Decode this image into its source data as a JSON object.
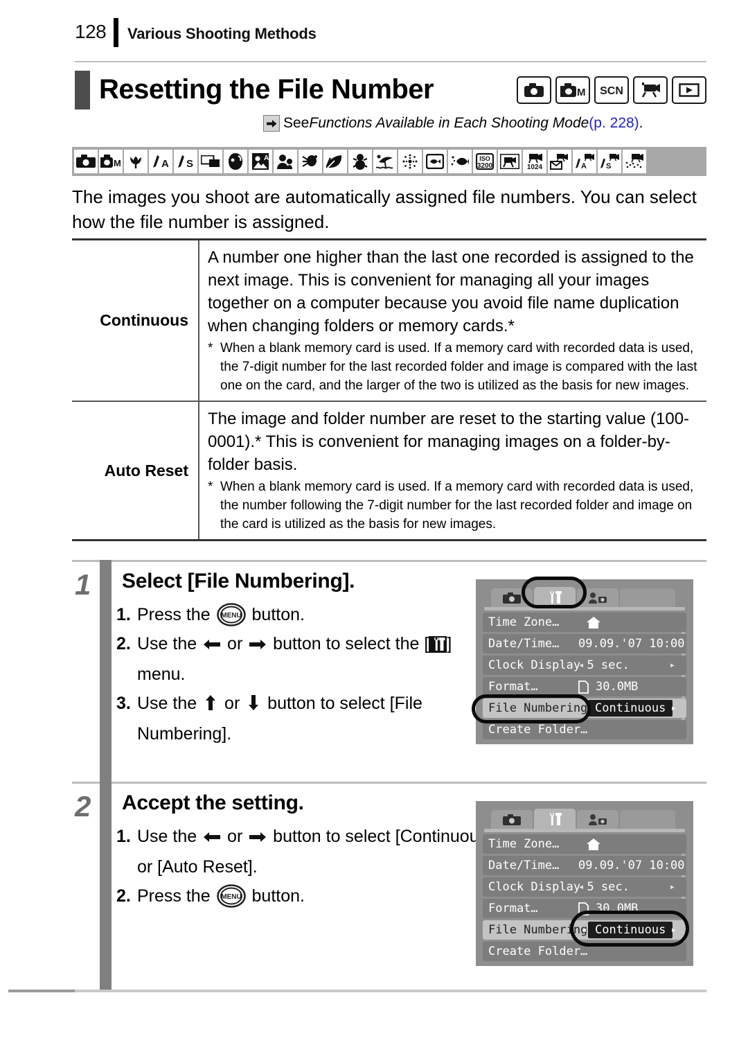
{
  "header": {
    "page_number": "128",
    "section_title": "Various Shooting Methods"
  },
  "title": {
    "text": "Resetting the File Number",
    "mode_badges": [
      {
        "name": "camera-auto-icon",
        "label": ""
      },
      {
        "name": "camera-manual-icon",
        "label": "M"
      },
      {
        "name": "scene-mode-icon",
        "label": "SCN"
      },
      {
        "name": "movie-mode-icon",
        "label": ""
      },
      {
        "name": "playback-mode-icon",
        "label": ""
      }
    ]
  },
  "see_reference": {
    "arrow": "➔",
    "prefix": "See ",
    "italic": "Functions Available in Each Shooting Mode",
    "page": " (p. 228)",
    "suffix": ".",
    "page_color": "#2222cc"
  },
  "icon_strip": [
    "camera-auto-icon",
    "camera-manual-icon",
    "macro-tulip-icon",
    "aperture-priority-av-icon",
    "shutter-priority-tv-icon",
    "stitch-assist-icon",
    "portrait-icon",
    "night-snapshot-icon",
    "kids-pets-icon",
    "indoor-icon",
    "foliage-icon",
    "snow-icon",
    "beach-icon",
    "fireworks-icon",
    "aquarium-icon",
    "underwater-icon",
    "iso3200-icon",
    "movie-standard-icon",
    "movie-1024-icon",
    "movie-compact-icon",
    "movie-color-accent-icon",
    "movie-color-swap-icon",
    "movie-fast-frame-icon"
  ],
  "intro": "The images you shoot are automatically assigned file numbers. You can select how the file number is assigned.",
  "table": {
    "rows": [
      {
        "label": "Continuous",
        "main": "A number one higher than the last one recorded is assigned to the next image. This is convenient for managing all your images together on a computer because you avoid file name duplication when changing folders or memory cards.*",
        "note_marker": "*",
        "note": "When a blank memory card is used. If a memory card with recorded data is used, the 7-digit number for the last recorded folder and image is compared with the last one on the card, and the larger of the two is utilized as the basis for new images."
      },
      {
        "label": "Auto Reset",
        "main": "The image and folder number are reset to the starting value (100-0001).* This is convenient for managing images on a folder-by-folder basis.",
        "note_marker": "*",
        "note": "When a blank memory card is used. If a memory card with recorded data is used, the number following the 7-digit number for the last recorded folder and image on the card is utilized as the basis for new images."
      }
    ]
  },
  "steps": [
    {
      "number": "1",
      "heading": "Select [File Numbering].",
      "items": [
        {
          "idx": "1.",
          "parts": [
            "Press the ",
            "MENU-BUTTON",
            " button."
          ]
        },
        {
          "idx": "2.",
          "parts": [
            "Use the ",
            "LEFT-ARROW",
            " or ",
            "RIGHT-ARROW",
            " button to select the [",
            "TOOLS-ICON",
            "] menu."
          ]
        },
        {
          "idx": "3.",
          "parts": [
            "Use the ",
            "UP-ARROW",
            " or ",
            "DOWN-ARROW",
            " button to select [File Numbering]."
          ]
        }
      ]
    },
    {
      "number": "2",
      "heading": "Accept the setting.",
      "items": [
        {
          "idx": "1.",
          "parts": [
            "Use the ",
            "LEFT-ARROW",
            " or ",
            "RIGHT-ARROW",
            " button to select [Continuous] or [Auto Reset]."
          ]
        },
        {
          "idx": "2.",
          "parts": [
            "Press the ",
            "MENU-BUTTON",
            " button."
          ]
        }
      ]
    }
  ],
  "lcd_screens": [
    {
      "id": "screen-step-1",
      "tabs": [
        "camera-tab",
        "tools-tab",
        "my-camera-tab"
      ],
      "active_tab_index": 1,
      "rows": [
        {
          "label": "Time Zone…",
          "value": "",
          "value_icon": "home-icon",
          "selected": false
        },
        {
          "label": "Date/Time…",
          "value": "09.09.'07 10:00",
          "selected": false
        },
        {
          "label": "Clock Display",
          "value": "5 sec.",
          "carets": true,
          "selected": false
        },
        {
          "label": "Format…",
          "value": "30.0MB",
          "value_icon": "card-icon",
          "selected": false
        },
        {
          "label": "File Numbering",
          "value": "Continuous",
          "value_boxed": true,
          "caret_right": true,
          "selected": true
        },
        {
          "label": "Create Folder…",
          "value": "",
          "selected": false
        }
      ],
      "highlights": [
        "tools-tab-oval",
        "file-numbering-label-oval"
      ]
    },
    {
      "id": "screen-step-2",
      "tabs": [
        "camera-tab",
        "tools-tab",
        "my-camera-tab"
      ],
      "active_tab_index": 1,
      "rows": [
        {
          "label": "Time Zone…",
          "value": "",
          "value_icon": "home-icon",
          "selected": false
        },
        {
          "label": "Date/Time…",
          "value": "09.09.'07 10:00",
          "selected": false
        },
        {
          "label": "Clock Display",
          "value": "5 sec.",
          "carets": true,
          "selected": false
        },
        {
          "label": "Format…",
          "value": "30.0MB",
          "value_icon": "card-icon",
          "selected": false
        },
        {
          "label": "File Numbering",
          "value": "Continuous",
          "value_boxed": true,
          "carets": true,
          "selected": true
        },
        {
          "label": "Create Folder…",
          "value": "",
          "selected": false
        }
      ],
      "highlights": [
        "continuous-value-oval"
      ]
    }
  ]
}
